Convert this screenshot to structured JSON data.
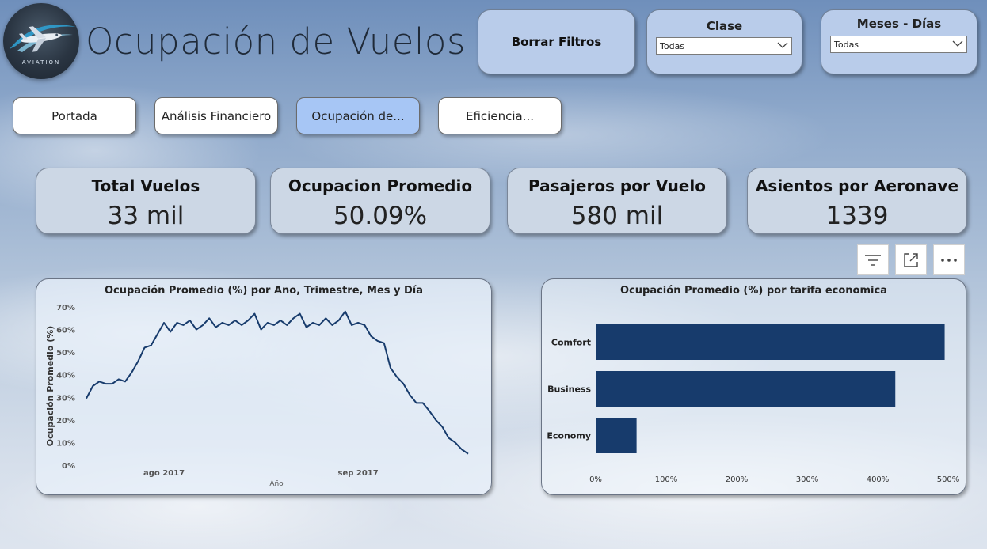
{
  "header": {
    "title": "Ocupación de Vuelos",
    "logo_text": "AVIATION"
  },
  "controls": {
    "clear_filters_label": "Borrar Filtros",
    "class_slicer": {
      "title": "Clase",
      "value": "Todas"
    },
    "months_slicer": {
      "title": "Meses - Días",
      "value": "Todas"
    }
  },
  "nav": {
    "buttons": [
      {
        "label": "Portada",
        "active": false
      },
      {
        "label": "Análisis Financiero",
        "active": false
      },
      {
        "label": "Ocupación de...",
        "active": true
      },
      {
        "label": "Eficiencia...",
        "active": false
      }
    ]
  },
  "kpis": [
    {
      "label": "Total Vuelos",
      "value": "33 mil"
    },
    {
      "label": "Ocupacion Promedio",
      "value": "50.09%"
    },
    {
      "label": "Pasajeros por Vuelo",
      "value": "580 mil"
    },
    {
      "label": "Asientos por Aeronave",
      "value": "1339"
    }
  ],
  "visual_header_icons": [
    "filter-icon",
    "focus-mode-icon",
    "more-options-icon"
  ],
  "colors": {
    "series": "#173b6c",
    "active_nav": "#a7c6f5",
    "panel": "#b9ccea"
  },
  "chart_data": [
    {
      "type": "line",
      "title": "Ocupación Promedio (%) por Año, Trimestre, Mes y Día",
      "xlabel": "Año",
      "ylabel": "Ocupación Promedio (%)",
      "y_ticks": [
        "70%",
        "60%",
        "50%",
        "40%",
        "30%",
        "20%",
        "10%",
        "0%"
      ],
      "ylim": [
        0,
        70
      ],
      "x_tick_labels": [
        {
          "label": "ago 2017",
          "index": 12
        },
        {
          "label": "sep 2017",
          "index": 42
        }
      ],
      "series": [
        {
          "values": [
            29.5,
            35,
            37,
            36,
            36,
            38,
            37,
            41,
            46,
            52,
            53,
            58,
            63,
            59,
            63,
            62,
            64,
            60,
            62,
            65,
            61,
            63,
            62,
            64,
            62,
            64,
            67,
            60,
            63,
            62,
            64,
            62,
            65,
            67,
            61,
            63,
            62,
            65,
            62,
            64,
            68,
            62,
            63,
            62,
            57,
            55,
            54,
            43,
            39,
            36,
            31,
            27.5,
            27.5,
            24,
            20,
            17,
            12,
            10,
            7,
            5
          ]
        }
      ]
    },
    {
      "type": "bar",
      "orientation": "horizontal",
      "title": "Ocupación Promedio (%) por tarifa economica",
      "categories": [
        "Comfort",
        "Business",
        "Economy"
      ],
      "values": [
        495,
        425,
        58
      ],
      "x_ticks": [
        "0%",
        "100%",
        "200%",
        "300%",
        "400%",
        "500%"
      ],
      "xlim": [
        0,
        500
      ]
    }
  ]
}
